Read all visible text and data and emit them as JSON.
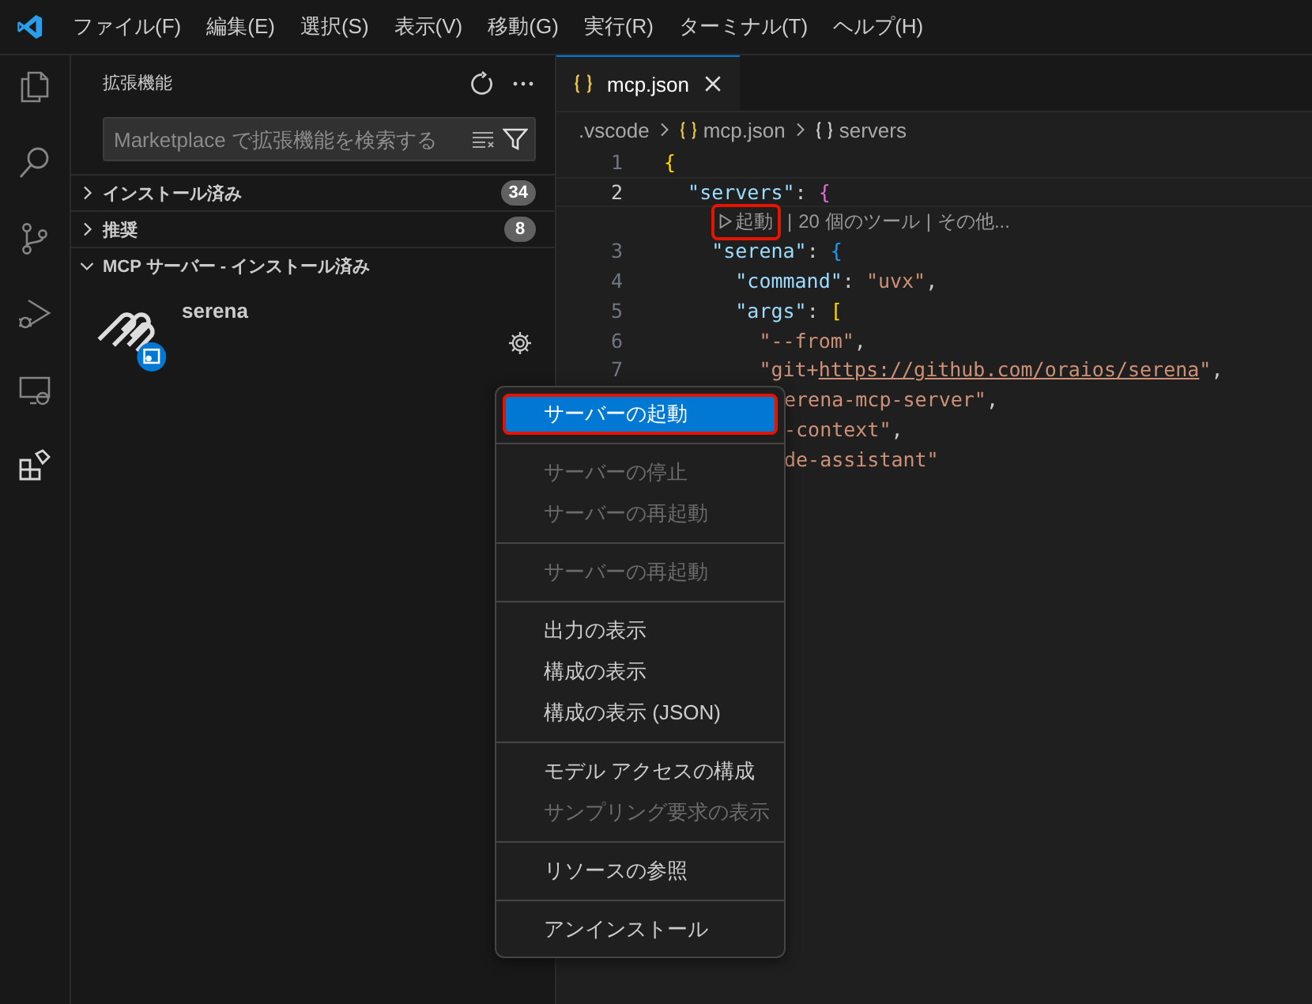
{
  "menubar": {
    "items": [
      "ファイル(F)",
      "編集(E)",
      "選択(S)",
      "表示(V)",
      "移動(G)",
      "実行(R)",
      "ターミナル(T)",
      "ヘルプ(H)"
    ]
  },
  "activity_bar": [
    {
      "kind": "files",
      "selected": false
    },
    {
      "kind": "search",
      "selected": false
    },
    {
      "kind": "source-control",
      "selected": false
    },
    {
      "kind": "debug",
      "selected": false
    },
    {
      "kind": "remote",
      "selected": false
    },
    {
      "kind": "extensions",
      "selected": true
    }
  ],
  "sidebar": {
    "title": "拡張機能",
    "search": {
      "placeholder": "Marketplace で拡張機能を検索する"
    },
    "sections": [
      {
        "label": "インストール済み",
        "count": "34",
        "expanded": false
      },
      {
        "label": "推奨",
        "count": "8",
        "expanded": false
      },
      {
        "label": "MCP サーバー - インストール済み",
        "expanded": true,
        "items": [
          {
            "name": "serena"
          }
        ]
      }
    ]
  },
  "editor": {
    "tab": {
      "label": "mcp.json",
      "selected": true
    },
    "breadcrumbs": [
      ".vscode",
      "mcp.json",
      "servers"
    ],
    "lines": [
      {
        "kind": "code",
        "number": "1",
        "current": false,
        "tokens": [
          {
            "text": "{",
            "kind": "brace1"
          }
        ]
      },
      {
        "kind": "code",
        "number": "2",
        "current": true,
        "tokens": [
          {
            "text": "  \"servers\"",
            "kind": "key"
          },
          {
            "text": ": ",
            "kind": "punct"
          },
          {
            "text": "{",
            "kind": "brace2"
          }
        ]
      },
      {
        "kind": "codelens",
        "action": "起動",
        "highlight": true,
        "separator": "|",
        "parts": [
          "20 個のツール",
          "その他..."
        ]
      },
      {
        "kind": "code",
        "number": "3",
        "current": false,
        "tokens": [
          {
            "text": "    \"serena\"",
            "kind": "key"
          },
          {
            "text": ": ",
            "kind": "punct"
          },
          {
            "text": "{",
            "kind": "brace3"
          }
        ]
      },
      {
        "kind": "code",
        "number": "4",
        "current": false,
        "tokens": [
          {
            "text": "      \"command\"",
            "kind": "key"
          },
          {
            "text": ": ",
            "kind": "punct"
          },
          {
            "text": "\"uvx\"",
            "kind": "string"
          },
          {
            "text": ",",
            "kind": "punct"
          }
        ]
      },
      {
        "kind": "code",
        "number": "5",
        "current": false,
        "tokens": [
          {
            "text": "      \"args\"",
            "kind": "key"
          },
          {
            "text": ": ",
            "kind": "punct"
          },
          {
            "text": "[",
            "kind": "brace1"
          }
        ]
      },
      {
        "kind": "code",
        "number": "6",
        "current": false,
        "tokens": [
          {
            "text": "        \"--from\"",
            "kind": "string"
          },
          {
            "text": ",",
            "kind": "punct"
          }
        ]
      },
      {
        "kind": "code",
        "number": "7",
        "current": false,
        "tokens": [
          {
            "text": "        \"git+",
            "kind": "string"
          },
          {
            "text": "https://github.com/oraios/serena",
            "kind": "link"
          },
          {
            "text": "\"",
            "kind": "string"
          },
          {
            "text": ",",
            "kind": "punct"
          }
        ]
      },
      {
        "kind": "clipped",
        "tokens": [
          {
            "text": "erena-mcp-server\"",
            "kind": "string"
          },
          {
            "text": ",",
            "kind": "punct"
          }
        ]
      },
      {
        "kind": "clipped",
        "tokens": [
          {
            "text": "-context\"",
            "kind": "string"
          },
          {
            "text": ",",
            "kind": "punct"
          }
        ]
      },
      {
        "kind": "clipped",
        "tokens": [
          {
            "text": "de-assistant\"",
            "kind": "string"
          }
        ]
      }
    ]
  },
  "context_menu": {
    "groups": [
      [
        {
          "label": "サーバーの起動",
          "selected": true,
          "disabled": false,
          "highlight": true
        }
      ],
      [
        {
          "label": "サーバーの停止",
          "selected": false,
          "disabled": true,
          "highlight": false
        },
        {
          "label": "サーバーの再起動",
          "selected": false,
          "disabled": true,
          "highlight": false
        }
      ],
      [
        {
          "label": "サーバーの再起動",
          "selected": false,
          "disabled": true,
          "highlight": false
        }
      ],
      [
        {
          "label": "出力の表示",
          "selected": false,
          "disabled": false,
          "highlight": false
        },
        {
          "label": "構成の表示",
          "selected": false,
          "disabled": false,
          "highlight": false
        },
        {
          "label": "構成の表示 (JSON)",
          "selected": false,
          "disabled": false,
          "highlight": false
        }
      ],
      [
        {
          "label": "モデル アクセスの構成",
          "selected": false,
          "disabled": false,
          "highlight": false
        },
        {
          "label": "サンプリング要求の表示",
          "selected": false,
          "disabled": true,
          "highlight": false
        }
      ],
      [
        {
          "label": "リソースの参照",
          "selected": false,
          "disabled": false,
          "highlight": false
        }
      ],
      [
        {
          "label": "アンインストール",
          "selected": false,
          "disabled": false,
          "highlight": false
        }
      ]
    ]
  }
}
